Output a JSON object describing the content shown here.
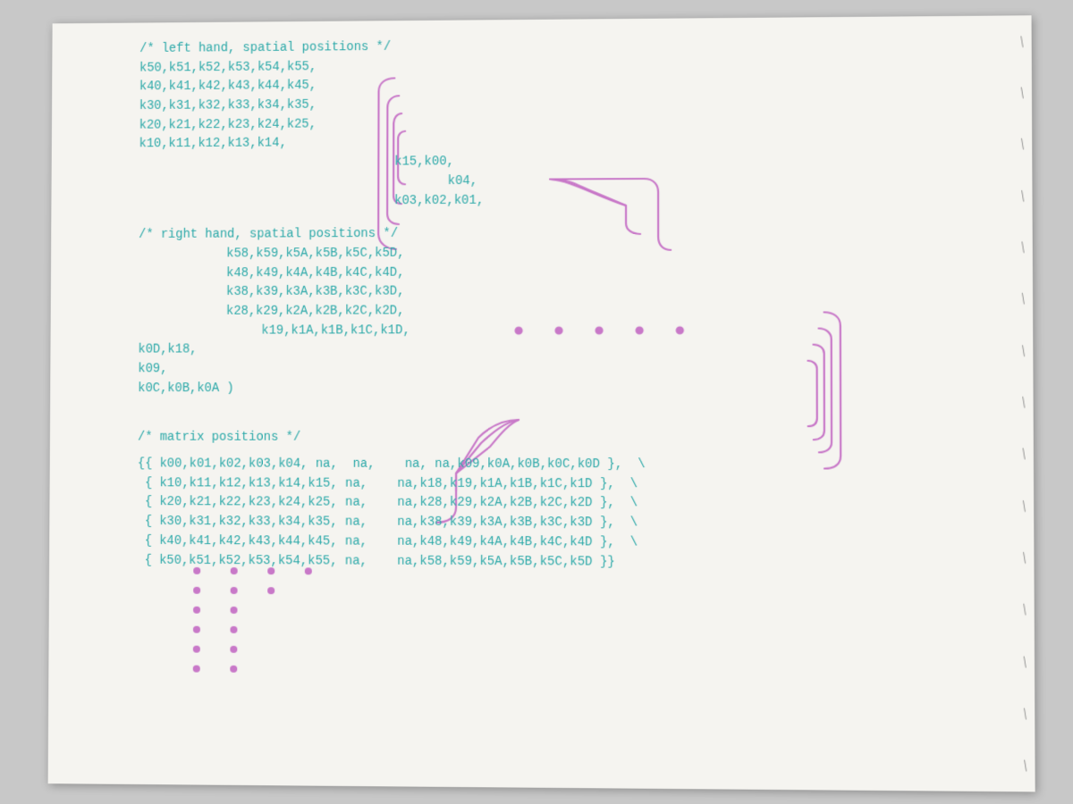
{
  "page": {
    "background": "#f5f4f0",
    "code_color": "#2aa8a8",
    "annotation_color": "#c878c8",
    "left_hand_comment": "/* left hand, spatial positions */",
    "left_hand_rows": [
      "k50,k51,k52,k53,k54,k55,",
      "k40,k41,k42,k43,k44,k45,",
      "k30,k31,k32,k33,k34,k35,",
      "k20,k21,k22,k23,k24,k25,",
      "k10,k11,k12,k13,k14,",
      "                              k15,k00,",
      "                                  k04,",
      "                              k03,k02,k01,"
    ],
    "right_hand_comment": "/* right hand, spatial positions */",
    "right_hand_rows": [
      "        k58,k59,k5A,k5B,k5C,k5D,",
      "        k48,k49,k4A,k4B,k4C,k4D,",
      "        k38,k39,k3A,k3B,k3C,k3D,",
      "        k28,k29,k2A,k2B,k2C,k2D,",
      "            k19,k1A,k1B,k1C,k1D,",
      "k0D,k18,",
      "k09,",
      "k0C,k0B,k0A )"
    ],
    "matrix_comment": "/* matrix positions */",
    "matrix_rows": [
      "{{ k00,k01,k02,k03,k04, na,  na,    na, na,k09,k0A,k0B,k0C,k0D },,",
      " { k10,k11,k12,k13,k14,k15, na,    na,k18,k19,k1A,k1B,k1C,k1D },",
      " { k20,k21,k22,k23,k24,k25, na,    na,k28,k29,k2A,k2B,k2C,k2D },",
      " { k30,k31,k32,k33,k34,k35, na,    na,k38,k39,k3A,k3B,k3C,k3D },",
      " { k40,k41,k42,k43,k44,k45, na,    na,k48,k49,k4A,k4B,k4C,k4D },",
      " { k50,k51,k52,k53,k54,k55, na,    na,k58,k59,k5A,k5B,k5C,k5D }}"
    ]
  }
}
